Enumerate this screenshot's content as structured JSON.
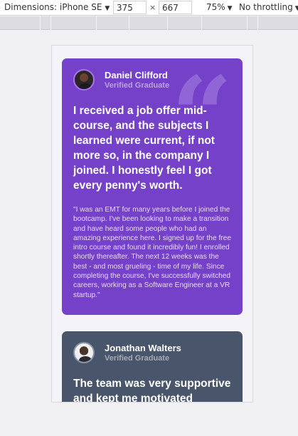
{
  "devtools": {
    "device_label": "Dimensions: iPhone SE",
    "width_value": "375",
    "times": "×",
    "height_value": "667",
    "zoom_label": "75%",
    "throttle_label": "No throttling",
    "caret": "▼"
  },
  "testimonials": [
    {
      "name": "Daniel Clifford",
      "role": "Verified Graduate",
      "headline": "I received a job offer mid-course, and the subjects I learned were current, if not more so, in the company I joined. I honestly feel I got every penny's worth.",
      "quote": "\"I was an EMT for many years before I joined the bootcamp. I've been looking to make a transition and have heard some people who had an amazing experience here. I signed up for the free intro course and found it incredibly fun! I enrolled shortly thereafter. The next 12 weeks was the best - and most grueling - time of my life. Since completing the course, I've successfully switched careers, working as a Software Engineer at a VR startup.\"",
      "quote_mark": "“",
      "color": "#7541c8"
    },
    {
      "name": "Jonathan Walters",
      "role": "Verified Graduate",
      "headline": "The team was very supportive and kept me motivated",
      "color": "#48556a"
    }
  ]
}
